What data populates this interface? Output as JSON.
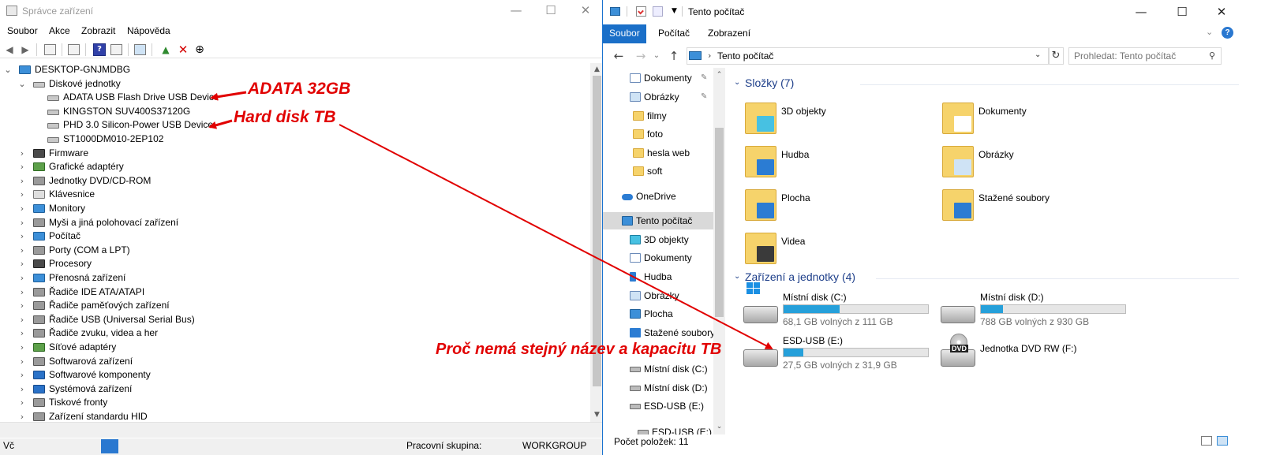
{
  "device_manager": {
    "title": "Správce zařízení",
    "menu": [
      "Soubor",
      "Akce",
      "Zobrazit",
      "Nápověda"
    ],
    "tree": [
      {
        "label": "DESKTOP-GNJMDBG",
        "level": 0,
        "twisty": "expanded",
        "icon": "computer-icon"
      },
      {
        "label": "Diskové jednotky",
        "level": 1,
        "twisty": "expanded",
        "icon": "disk-drive-icon"
      },
      {
        "label": "ADATA USB Flash Drive USB Device",
        "level": 2,
        "twisty": "none",
        "icon": "disk-drive-icon"
      },
      {
        "label": "KINGSTON SUV400S37120G",
        "level": 2,
        "twisty": "none",
        "icon": "disk-drive-icon"
      },
      {
        "label": "PHD 3.0 Silicon-Power USB Device",
        "level": 2,
        "twisty": "none",
        "icon": "disk-drive-icon"
      },
      {
        "label": "ST1000DM010-2EP102",
        "level": 2,
        "twisty": "none",
        "icon": "disk-drive-icon"
      },
      {
        "label": "Firmware",
        "level": 1,
        "twisty": "collapsed",
        "icon": "firmware-icon"
      },
      {
        "label": "Grafické adaptéry",
        "level": 1,
        "twisty": "collapsed",
        "icon": "display-adapter-icon"
      },
      {
        "label": "Jednotky DVD/CD-ROM",
        "level": 1,
        "twisty": "collapsed",
        "icon": "dvd-icon"
      },
      {
        "label": "Klávesnice",
        "level": 1,
        "twisty": "collapsed",
        "icon": "keyboard-icon"
      },
      {
        "label": "Monitory",
        "level": 1,
        "twisty": "collapsed",
        "icon": "monitor-icon"
      },
      {
        "label": "Myši a jiná polohovací zařízení",
        "level": 1,
        "twisty": "collapsed",
        "icon": "mouse-icon"
      },
      {
        "label": "Počítač",
        "level": 1,
        "twisty": "collapsed",
        "icon": "computer-icon"
      },
      {
        "label": "Porty (COM a LPT)",
        "level": 1,
        "twisty": "collapsed",
        "icon": "port-icon"
      },
      {
        "label": "Procesory",
        "level": 1,
        "twisty": "collapsed",
        "icon": "processor-icon"
      },
      {
        "label": "Přenosná zařízení",
        "level": 1,
        "twisty": "collapsed",
        "icon": "portable-device-icon"
      },
      {
        "label": "Řadiče IDE ATA/ATAPI",
        "level": 1,
        "twisty": "collapsed",
        "icon": "ide-controller-icon"
      },
      {
        "label": "Řadiče paměťových zařízení",
        "level": 1,
        "twisty": "collapsed",
        "icon": "storage-controller-icon"
      },
      {
        "label": "Řadiče USB (Universal Serial Bus)",
        "level": 1,
        "twisty": "collapsed",
        "icon": "usb-icon"
      },
      {
        "label": "Řadiče zvuku, videa a her",
        "level": 1,
        "twisty": "collapsed",
        "icon": "speaker-icon"
      },
      {
        "label": "Síťové adaptéry",
        "level": 1,
        "twisty": "collapsed",
        "icon": "network-adapter-icon"
      },
      {
        "label": "Softwarová zařízení",
        "level": 1,
        "twisty": "collapsed",
        "icon": "software-device-icon"
      },
      {
        "label": "Softwarové komponenty",
        "level": 1,
        "twisty": "collapsed",
        "icon": "software-component-icon"
      },
      {
        "label": "Systémová zařízení",
        "level": 1,
        "twisty": "collapsed",
        "icon": "system-device-icon"
      },
      {
        "label": "Tiskové fronty",
        "level": 1,
        "twisty": "collapsed",
        "icon": "printer-icon"
      },
      {
        "label": "Zařízení standardu HID",
        "level": 1,
        "twisty": "collapsed",
        "icon": "hid-icon"
      }
    ],
    "status_left": "Vč",
    "status_workgroup_label": "Pracovní skupina:",
    "status_workgroup_value": "WORKGROUP"
  },
  "explorer": {
    "title": "Tento počítač",
    "ribbon_tabs": [
      "Soubor",
      "Počítač",
      "Zobrazení"
    ],
    "address": "Tento počítač",
    "search_placeholder": "Prohledat: Tento počítač",
    "nav_items": [
      {
        "label": "Dokumenty",
        "icon": "documents-icon",
        "pinned": true
      },
      {
        "label": "Obrázky",
        "icon": "pictures-icon",
        "pinned": true
      },
      {
        "label": "filmy",
        "icon": "folder-icon",
        "pinned": false
      },
      {
        "label": "foto",
        "icon": "folder-icon",
        "pinned": false
      },
      {
        "label": "hesla web",
        "icon": "folder-icon",
        "pinned": false
      },
      {
        "label": "soft",
        "icon": "folder-icon",
        "pinned": false
      },
      {
        "label": "OneDrive",
        "icon": "onedrive-icon",
        "pinned": false
      },
      {
        "label": "Tento počítač",
        "icon": "this-pc-icon",
        "pinned": false,
        "selected": true
      },
      {
        "label": "3D objekty",
        "icon": "3d-objects-icon",
        "pinned": false
      },
      {
        "label": "Dokumenty",
        "icon": "documents-icon",
        "pinned": false
      },
      {
        "label": "Hudba",
        "icon": "music-icon",
        "pinned": false
      },
      {
        "label": "Obrázky",
        "icon": "pictures-icon",
        "pinned": false
      },
      {
        "label": "Plocha",
        "icon": "desktop-icon",
        "pinned": false
      },
      {
        "label": "Stažené soubory",
        "icon": "downloads-icon",
        "pinned": false
      },
      {
        "label": "Místní disk (C:)",
        "icon": "drive-icon",
        "pinned": false
      },
      {
        "label": "Místní disk (D:)",
        "icon": "drive-icon",
        "pinned": false
      },
      {
        "label": "ESD-USB (E:)",
        "icon": "usb-drive-icon",
        "pinned": false
      },
      {
        "label": "ESD-USB (E:)",
        "icon": "usb-drive-icon",
        "pinned": false
      }
    ],
    "folders_header": "Složky (7)",
    "folders": [
      {
        "label": "3D objekty",
        "icon": "3d-objects-folder-icon"
      },
      {
        "label": "Dokumenty",
        "icon": "documents-folder-icon"
      },
      {
        "label": "Hudba",
        "icon": "music-folder-icon"
      },
      {
        "label": "Obrázky",
        "icon": "pictures-folder-icon"
      },
      {
        "label": "Plocha",
        "icon": "desktop-folder-icon"
      },
      {
        "label": "Stažené soubory",
        "icon": "downloads-folder-icon"
      },
      {
        "label": "Videa",
        "icon": "videos-folder-icon"
      }
    ],
    "drives_header": "Zařízení a jednotky (4)",
    "drives": [
      {
        "name": "Místní disk (C:)",
        "free": "68,1 GB volných z 111 GB",
        "used_fraction": 0.386,
        "icon": "windows-drive-icon"
      },
      {
        "name": "Místní disk (D:)",
        "free": "788 GB volných z 930 GB",
        "used_fraction": 0.153,
        "icon": "drive-icon"
      },
      {
        "name": "ESD-USB (E:)",
        "free": "27,5 GB volných z 31,9 GB",
        "used_fraction": 0.138,
        "icon": "usb-drive-icon"
      },
      {
        "name": "Jednotka DVD RW (F:)",
        "free": "",
        "used_fraction": null,
        "icon": "dvd-drive-icon",
        "badge": "DVD"
      }
    ],
    "status_count": "Počet položek: 11"
  },
  "annotations": {
    "adata": "ADATA 32GB",
    "hard_disk": "Hard disk TB",
    "question": "Proč nemá stejný název a kapacitu TB",
    "color": "#e10000"
  },
  "colors": {
    "accent": "#1a6fc8",
    "usage_bar": "#26a0da",
    "group_header": "#1e3f8a"
  }
}
